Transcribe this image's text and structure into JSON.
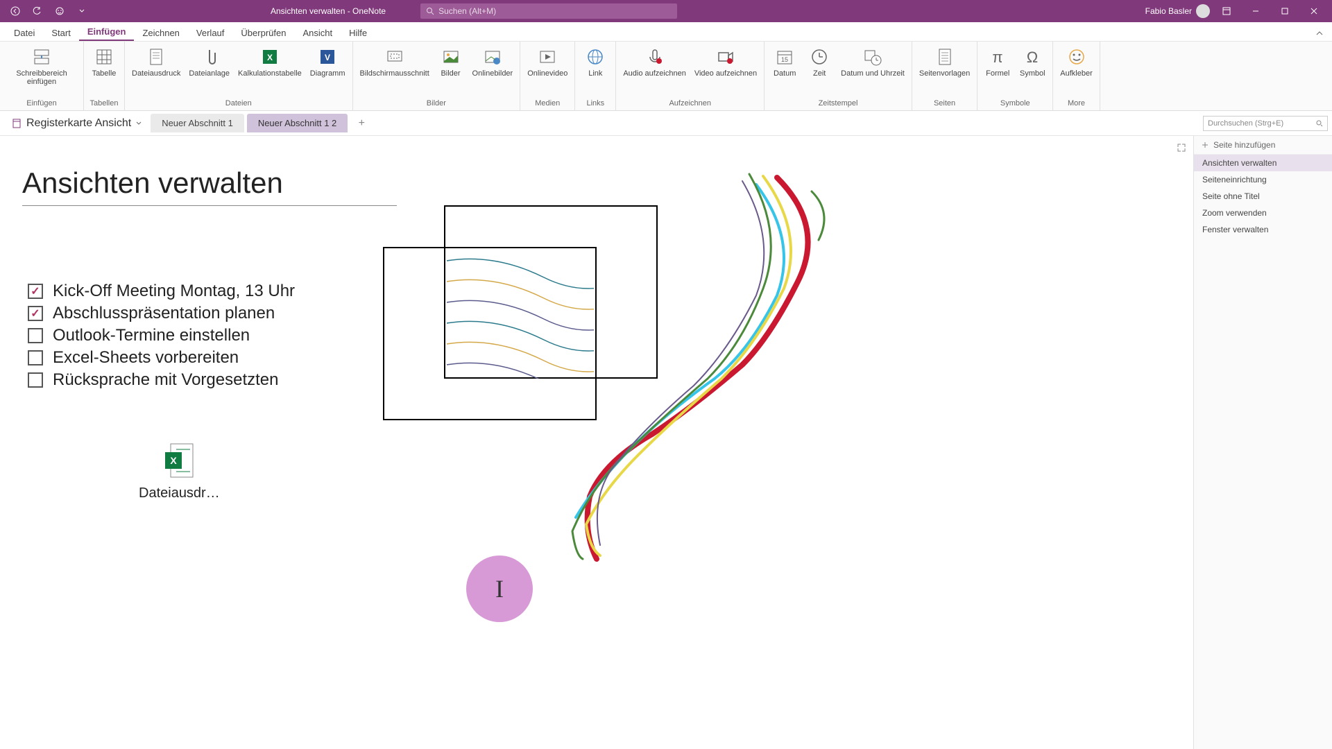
{
  "titlebar": {
    "title": "Ansichten verwalten  -  OneNote",
    "search_placeholder": "Suchen (Alt+M)",
    "username": "Fabio Basler"
  },
  "menu": {
    "tabs": [
      "Datei",
      "Start",
      "Einfügen",
      "Zeichnen",
      "Verlauf",
      "Überprüfen",
      "Ansicht",
      "Hilfe"
    ],
    "active_index": 2
  },
  "ribbon": {
    "groups": [
      {
        "label": "Einfügen",
        "items": [
          {
            "label": "Schreibbereich einfügen",
            "icon": "insert-space"
          }
        ]
      },
      {
        "label": "Tabellen",
        "items": [
          {
            "label": "Tabelle",
            "icon": "table"
          }
        ]
      },
      {
        "label": "Dateien",
        "items": [
          {
            "label": "Dateiausdruck",
            "icon": "file-print"
          },
          {
            "label": "Dateianlage",
            "icon": "attachment"
          },
          {
            "label": "Kalkulationstabelle",
            "icon": "spreadsheet"
          },
          {
            "label": "Diagramm",
            "icon": "diagram"
          }
        ]
      },
      {
        "label": "Bilder",
        "items": [
          {
            "label": "Bildschirmausschnitt",
            "icon": "screenshot"
          },
          {
            "label": "Bilder",
            "icon": "picture"
          },
          {
            "label": "Onlinebilder",
            "icon": "online-picture"
          }
        ]
      },
      {
        "label": "Medien",
        "items": [
          {
            "label": "Onlinevideo",
            "icon": "video"
          }
        ]
      },
      {
        "label": "Links",
        "items": [
          {
            "label": "Link",
            "icon": "link"
          }
        ]
      },
      {
        "label": "Aufzeichnen",
        "items": [
          {
            "label": "Audio aufzeichnen",
            "icon": "audio-rec"
          },
          {
            "label": "Video aufzeichnen",
            "icon": "video-rec"
          }
        ]
      },
      {
        "label": "Zeitstempel",
        "items": [
          {
            "label": "Datum",
            "icon": "date"
          },
          {
            "label": "Zeit",
            "icon": "time"
          },
          {
            "label": "Datum und Uhrzeit",
            "icon": "datetime"
          }
        ]
      },
      {
        "label": "Seiten",
        "items": [
          {
            "label": "Seitenvorlagen",
            "icon": "template"
          }
        ]
      },
      {
        "label": "Symbole",
        "items": [
          {
            "label": "Formel",
            "icon": "equation"
          },
          {
            "label": "Symbol",
            "icon": "symbol"
          }
        ]
      },
      {
        "label": "More",
        "items": [
          {
            "label": "Aufkleber",
            "icon": "sticker"
          }
        ]
      }
    ]
  },
  "sections": {
    "notebook_label": "Registerkarte Ansicht",
    "tabs": [
      {
        "label": "Neuer Abschnitt 1",
        "active": false
      },
      {
        "label": "Neuer Abschnitt 1 2",
        "active": true
      }
    ],
    "search_placeholder": "Durchsuchen (Strg+E)"
  },
  "page_panel": {
    "add_page": "Seite hinzufügen",
    "pages": [
      {
        "label": "Ansichten verwalten",
        "active": true
      },
      {
        "label": "Seiteneinrichtung",
        "active": false
      },
      {
        "label": "Seite ohne Titel",
        "active": false
      },
      {
        "label": "Zoom verwenden",
        "active": false
      },
      {
        "label": "Fenster verwalten",
        "active": false
      }
    ]
  },
  "page": {
    "title": "Ansichten verwalten",
    "checklist": [
      {
        "text": "Kick-Off Meeting Montag, 13 Uhr",
        "checked": true
      },
      {
        "text": "Abschlusspräsentation planen",
        "checked": true
      },
      {
        "text": "Outlook-Termine einstellen",
        "checked": false
      },
      {
        "text": "Excel-Sheets vorbereiten",
        "checked": false
      },
      {
        "text": "Rücksprache mit Vorgesetzten",
        "checked": false
      }
    ],
    "attachment_label": "Dateiausdr…"
  }
}
